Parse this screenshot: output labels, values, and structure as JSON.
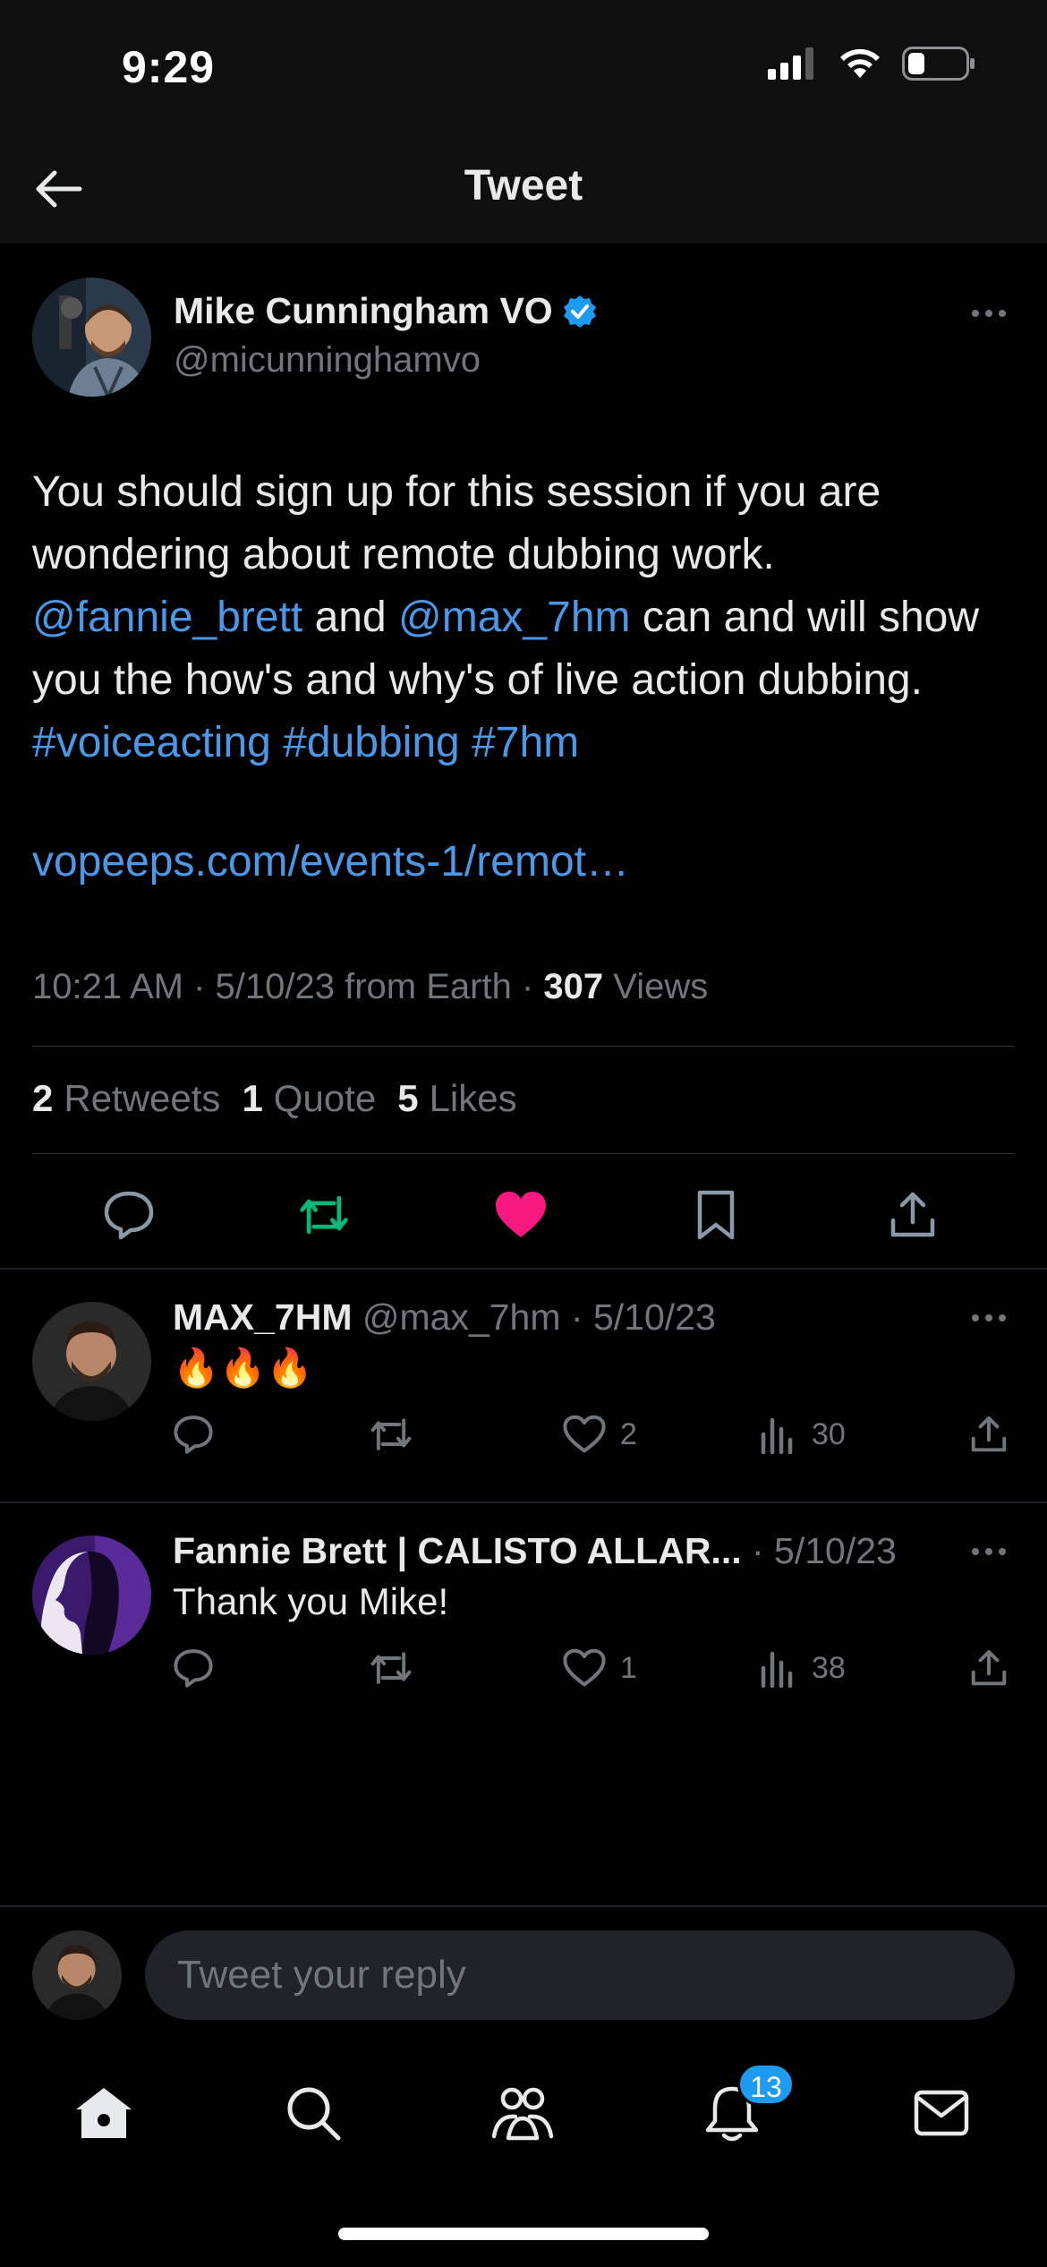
{
  "status_bar": {
    "time": "9:29"
  },
  "header": {
    "title": "Tweet"
  },
  "tweet": {
    "author_name": "Mike Cunningham VO",
    "author_handle": "@micunninghamvo",
    "text_1": "You should sign up for this session if you are wondering about remote dubbing work.",
    "mention_1": "@fannie_brett",
    "text_2": " and ",
    "mention_2": "@max_7hm",
    "text_3": " can and will show you the how's and why's of live action dubbing. ",
    "hashtag_1": "#voiceacting",
    "hashtag_2": "#dubbing",
    "hashtag_3": "#7hm",
    "url": "vopeeps.com/events-1/remot…",
    "meta_time": "10:21 AM · 5/10/23 from Earth · ",
    "views_count": "307",
    "views_label": " Views",
    "retweets_count": "2",
    "retweets_label": "Retweets",
    "quotes_count": "1",
    "quotes_label": "Quote",
    "likes_count": "5",
    "likes_label": "Likes"
  },
  "replies": [
    {
      "name": "MAX_7HM",
      "meta": " @max_7hm · 5/10/23",
      "text": "🔥🔥🔥",
      "likes": "2",
      "views": "30"
    },
    {
      "name": "Fannie Brett | CALISTO ALLAR...",
      "meta": " · 5/10/23",
      "text": "Thank you Mike!",
      "likes": "1",
      "views": "38"
    }
  ],
  "compose": {
    "placeholder": "Tweet your reply"
  },
  "tabbar": {
    "notifications_badge": "13"
  },
  "colors": {
    "accent": "#1d9bf0",
    "link": "#4a99e9",
    "retweet_green": "#00ba7c",
    "like_pink": "#f91880"
  }
}
